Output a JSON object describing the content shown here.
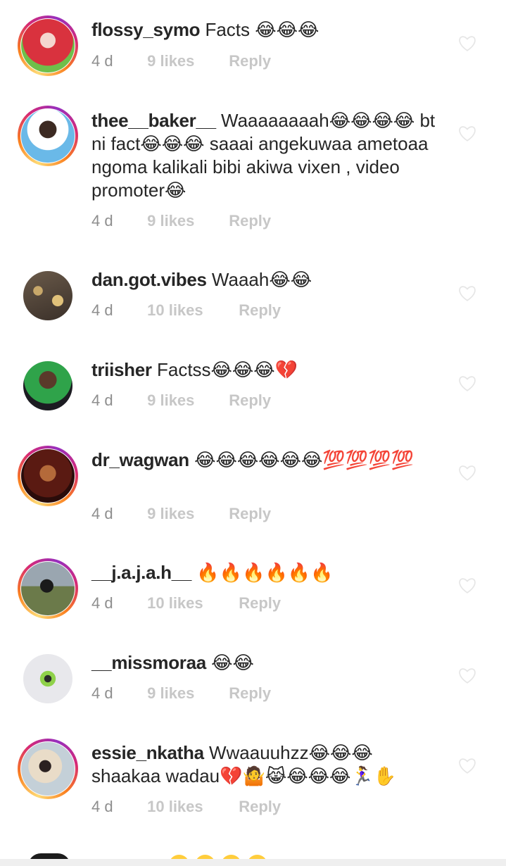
{
  "comments": [
    {
      "username": "flossy_symo",
      "text": "Facts 😂😂😂",
      "time": "4 d",
      "likes": "9 likes",
      "reply": "Reply"
    },
    {
      "username": "thee__baker__",
      "text": "Waaaaaaaah😂😂😂😂 bt ni fact😂😂😂 saaai angekuwaa ametoaa ngoma kalikali bibi akiwa vixen , video promoter😂",
      "time": "4 d",
      "likes": "9 likes",
      "reply": "Reply"
    },
    {
      "username": "dan.got.vibes",
      "text": "Waaah😂😂",
      "time": "4 d",
      "likes": "10 likes",
      "reply": "Reply"
    },
    {
      "username": "triisher",
      "text": "Factss😂😂😂💔",
      "time": "4 d",
      "likes": "9 likes",
      "reply": "Reply"
    },
    {
      "username": "dr_wagwan",
      "text": "😂😂😂😂😂😂💯💯💯💯",
      "time": "4 d",
      "likes": "9 likes",
      "reply": "Reply"
    },
    {
      "username": "__j.a.j.a.h__",
      "text": "🔥🔥🔥🔥🔥🔥",
      "time": "4 d",
      "likes": "10 likes",
      "reply": "Reply"
    },
    {
      "username": "__missmoraa",
      "text": "😂😂",
      "time": "4 d",
      "likes": "9 likes",
      "reply": "Reply"
    },
    {
      "username": "essie_nkatha",
      "text": "Wwaauuhzz😂😂😂 shaakaa wadau💔🤷😹😂😂😂🏃‍♀️✋",
      "time": "4 d",
      "likes": "10 likes",
      "reply": "Reply"
    }
  ],
  "icons": {
    "like": "heart-outline-icon",
    "avatar": "profile-picture"
  }
}
